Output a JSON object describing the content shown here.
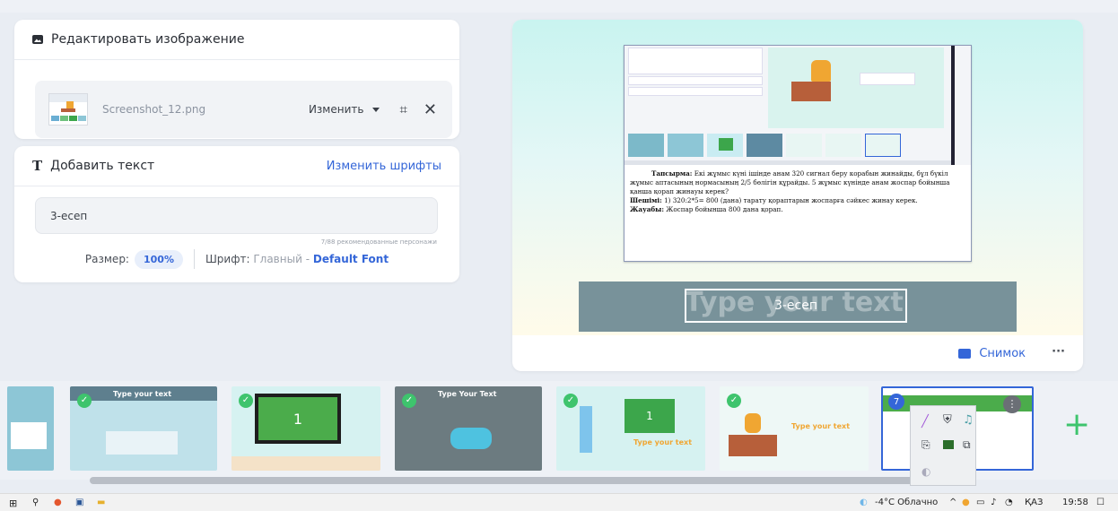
{
  "edit_panel": {
    "title": "Редактировать изображение",
    "file_name": "Screenshot_12.png",
    "change_label": "Изменить"
  },
  "text_panel": {
    "title": "Добавить текст",
    "change_fonts": "Изменить шрифты",
    "input_value": "3-есеп",
    "counter": "7/88 рекомендованные персонажи",
    "size_label": "Размер:",
    "size_value": "100%",
    "font_label": "Шрифт:",
    "font_primary": "Главный -",
    "font_name": "Default Font"
  },
  "preview": {
    "task_label": "Тапсырма:",
    "task_text": " Екі жұмыс күні ішінде анам 320 сигнал беру корабын жинайды, бұл бүкіл жұмыс аптасының нормасының 2/5 бөлігін құрайды. 5 жұмыс күнінде анам жоспар бойынша қанша қорап жинауы керек?",
    "solution_label": "Шешімі:",
    "solution_text": " 1) 320:2*5= 800 (дана) тарату қораптарын жоспарға сәйкес жинау керек.",
    "answer_label": "Жауабы:",
    "answer_text": " Жоспар бойынша 800 дана қорап.",
    "caption_ghost": "Type your text",
    "caption_value": "3-есеп",
    "snapshot_label": "Снимок",
    "more_label": "···"
  },
  "filmstrip": {
    "slides": [
      {
        "label": "Type your text",
        "number": ""
      },
      {
        "label": "",
        "number": "1"
      },
      {
        "label": "Type Your Text",
        "number": ""
      },
      {
        "label": "Type your text",
        "number": "1"
      },
      {
        "label": "Type your text",
        "number": ""
      },
      {
        "label": "",
        "number": "7"
      }
    ],
    "add_label": "+"
  },
  "taskbar": {
    "weather": "-4°C Облачно",
    "lang": "ҚАЗ",
    "time": "19:58"
  },
  "colors": {
    "accent": "#3466d8",
    "green": "#3ec46d",
    "caption_band": "#78929a",
    "slide_bg_green": "#4bac4b"
  }
}
